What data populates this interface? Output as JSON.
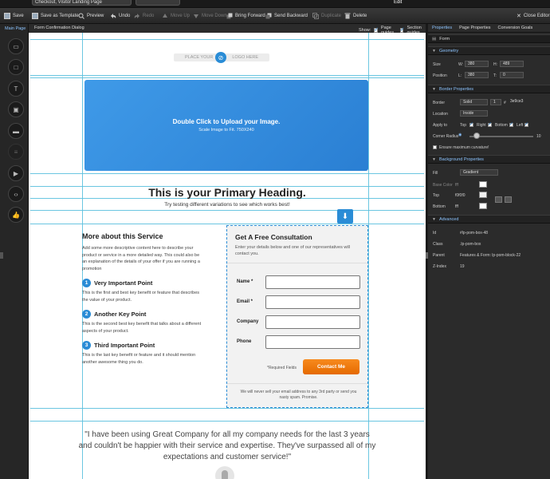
{
  "window": {
    "title": "Checkout, Visitor Landing Page",
    "mode_label": "Edit"
  },
  "toolbar": {
    "save": "Save",
    "save_template": "Save as Template",
    "preview": "Preview",
    "undo": "Undo",
    "redo": "Redo",
    "move_up": "Move Up",
    "move_down": "Move Down",
    "bring_forward": "Bring Forward",
    "send_backward": "Send Backward",
    "duplicate": "Duplicate",
    "delete": "Delete",
    "close_editor": "Close Editor"
  },
  "sidebar": {
    "label": "Main Page",
    "tools": [
      "section-icon",
      "box-icon",
      "text-icon",
      "image-icon",
      "button-icon",
      "form-icon",
      "video-icon",
      "code-icon",
      "social-icon"
    ]
  },
  "tabs": {
    "caption": "Form Confirmation Dialog",
    "show_label": "Show:",
    "page_guides": "Page guides",
    "section_guides": "Section guides"
  },
  "page": {
    "logo_left": "PLACE YOUR",
    "logo_right": "LOGO HERE",
    "hero_title": "Double Click to Upload your Image.",
    "hero_sub": "Scale Image to Fit. 750X240",
    "heading": "This is your Primary Heading.",
    "subheading": "Try testing different variations to see which works best!",
    "about": {
      "title": "More about this Service",
      "body": "Add some more descriptive content here to describe your product or service in a more detailed way. This could also be an explanation of the details of your offer if you are running a promotion",
      "points": [
        {
          "n": "1",
          "title": "Very Important Point",
          "text": "This is the first and best key benefit or feature that describes the value of your product."
        },
        {
          "n": "2",
          "title": "Another Key Point",
          "text": "This is the second best key benefit that talks about a different aspects of your product."
        },
        {
          "n": "3",
          "title": "Third Important Point",
          "text": "This is the last key benefit or feature and it should mention another awesome thing you do."
        }
      ]
    },
    "form": {
      "title": "Get A Free Consultation",
      "desc": "Enter your details below and one of our representatives will contact you.",
      "fields": [
        "Name *",
        "Email *",
        "Company",
        "Phone"
      ],
      "required_note": "*Required Fields",
      "button": "Contact Me",
      "footnote": "We will never sell your email address to any 3rd party or send you nasty spam. Promise."
    },
    "quote": "\"I have been using Great Company for all my company needs for the last 3 years and couldn't be happier with their service and expertise. They've surpassed all of my expectations and customer service!\""
  },
  "panel": {
    "tabs": [
      "Properties",
      "Page Properties",
      "Conversion Goals"
    ],
    "element": "Form",
    "geometry": {
      "title": "Geometry",
      "size_label": "Size",
      "w_label": "W:",
      "w": "380",
      "h_label": "H:",
      "h": "489",
      "pos_label": "Position",
      "l_label": "L:",
      "l": "380",
      "t_label": "T:",
      "t": "0"
    },
    "border": {
      "title": "Border Properties",
      "border_label": "Border",
      "style": "Solid",
      "width": "1",
      "color": "3e9ce3",
      "location_label": "Location",
      "location": "Inside",
      "apply_label": "Apply to",
      "top": "Top",
      "right": "Right",
      "bottom": "Bottom",
      "left": "Left",
      "radius_label": "Corner Radius",
      "radius": "10",
      "max_curv": "Ensure maximum curvature!"
    },
    "background": {
      "title": "Background Properties",
      "fill_label": "Fill",
      "fill": "Gradient",
      "base_label": "Base Color",
      "base": "fff",
      "top_label": "Top",
      "top": "f0f0f0",
      "bottom_label": "Bottom",
      "bottom": "fff"
    },
    "advanced": {
      "title": "Advanced",
      "id_label": "Id",
      "id": "#lp-pom-box-48",
      "class_label": "Class",
      "class": ".lp-pom-box",
      "parent_label": "Parent",
      "parent": "Features & Form: lp-pom-block-22",
      "z_label": "Z-Index",
      "z": "19"
    }
  }
}
